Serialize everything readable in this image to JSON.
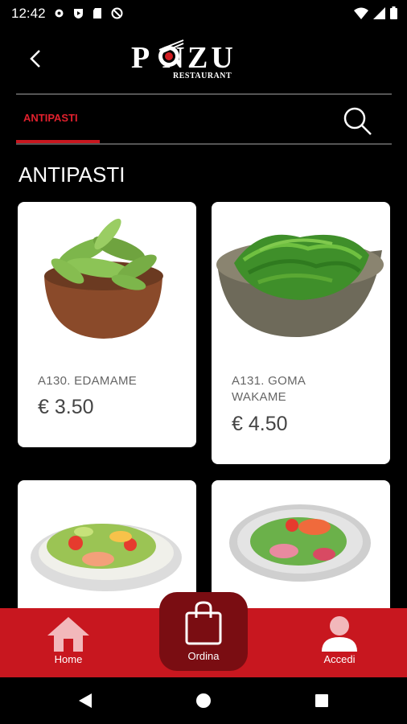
{
  "status_bar": {
    "time": "12:42"
  },
  "header": {
    "logo_text": "P NZU",
    "logo_sub": "RESTAURANT"
  },
  "tabs": [
    {
      "label": "ANTIPASTI",
      "active": true
    }
  ],
  "section": {
    "title": "ANTIPASTI"
  },
  "products": [
    {
      "name": "A130. EDAMAME",
      "price": "€ 3.50"
    },
    {
      "name": "A131. GOMA WAKAME",
      "price": "€ 4.50"
    },
    {
      "name": "",
      "price": ""
    },
    {
      "name": "",
      "price": ""
    }
  ],
  "bottom_nav": {
    "home": "Home",
    "ordina": "Ordina",
    "accedi": "Accedi"
  },
  "colors": {
    "accent": "#c8171f",
    "ordina_bg": "#7a0d12",
    "background": "#000000"
  }
}
